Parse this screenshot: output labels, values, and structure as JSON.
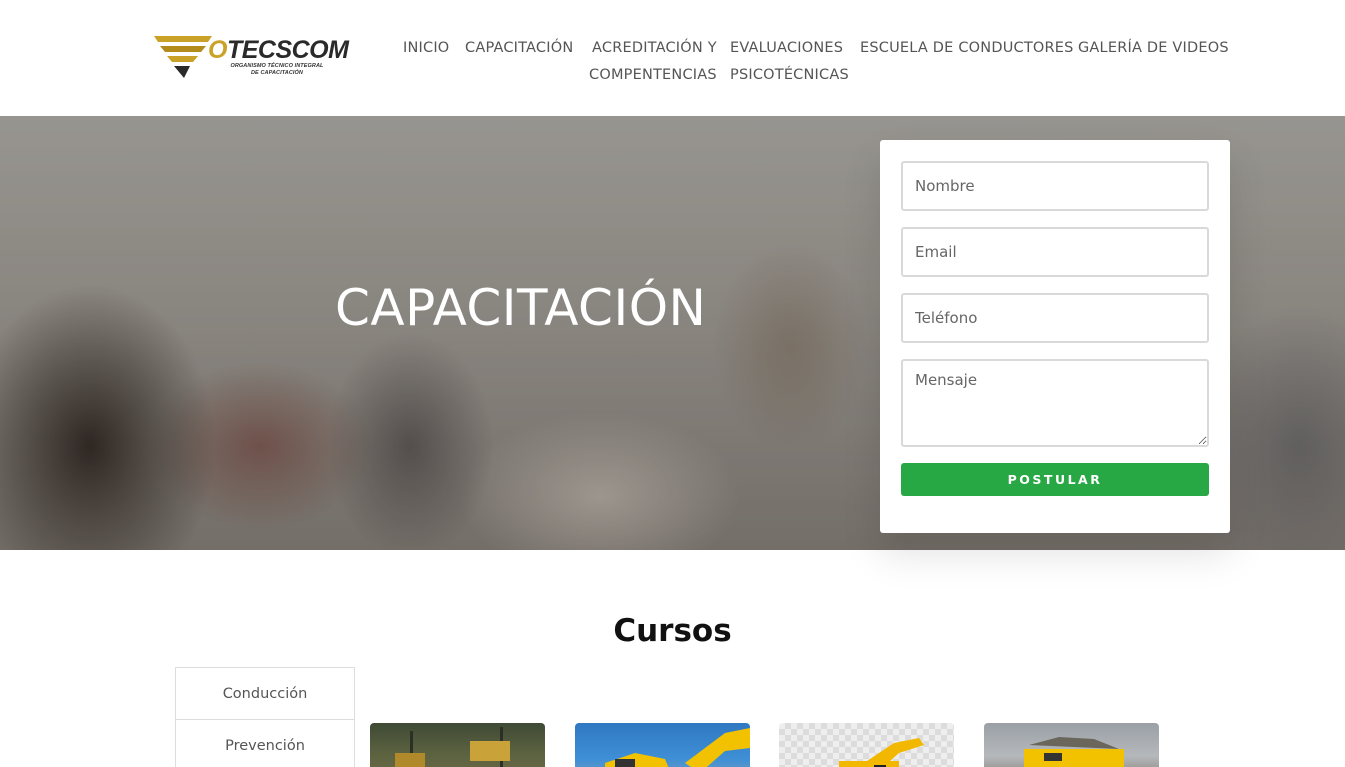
{
  "brand": {
    "name_first_letter": "O",
    "name_rest": "TECSCOM",
    "tagline_line1": "ORGANISMO TÉCNICO INTEGRAL",
    "tagline_line2": "DE CAPACITACIÓN",
    "gold": "#c9a227"
  },
  "nav": {
    "inicio": "INICIO",
    "capacitacion": "CAPACITACIÓN",
    "acreditacion_line1": "ACREDITACIÓN Y",
    "acreditacion_line2": "COMPENTENCIAS",
    "evaluaciones_line1": "EVALUACIONES",
    "evaluaciones_line2": "PSICOTÉCNICAS",
    "escuela": "ESCUELA DE CONDUCTORES",
    "galeria": "GALERÍA DE VIDEOS"
  },
  "hero": {
    "title": "CAPACITACIÓN"
  },
  "form": {
    "nombre_placeholder": "Nombre",
    "email_placeholder": "Email",
    "telefono_placeholder": "Teléfono",
    "mensaje_placeholder": "Mensaje",
    "submit_label": "POSTULAR",
    "submit_color": "#28a745"
  },
  "cursos": {
    "title": "Cursos",
    "tabs": [
      "Conducción",
      "Prevención"
    ],
    "cards": [
      {
        "icon": "loader-machine-icon"
      },
      {
        "icon": "excavator-icon"
      },
      {
        "icon": "cat-excavator-icon"
      },
      {
        "icon": "dump-truck-icon"
      }
    ]
  }
}
